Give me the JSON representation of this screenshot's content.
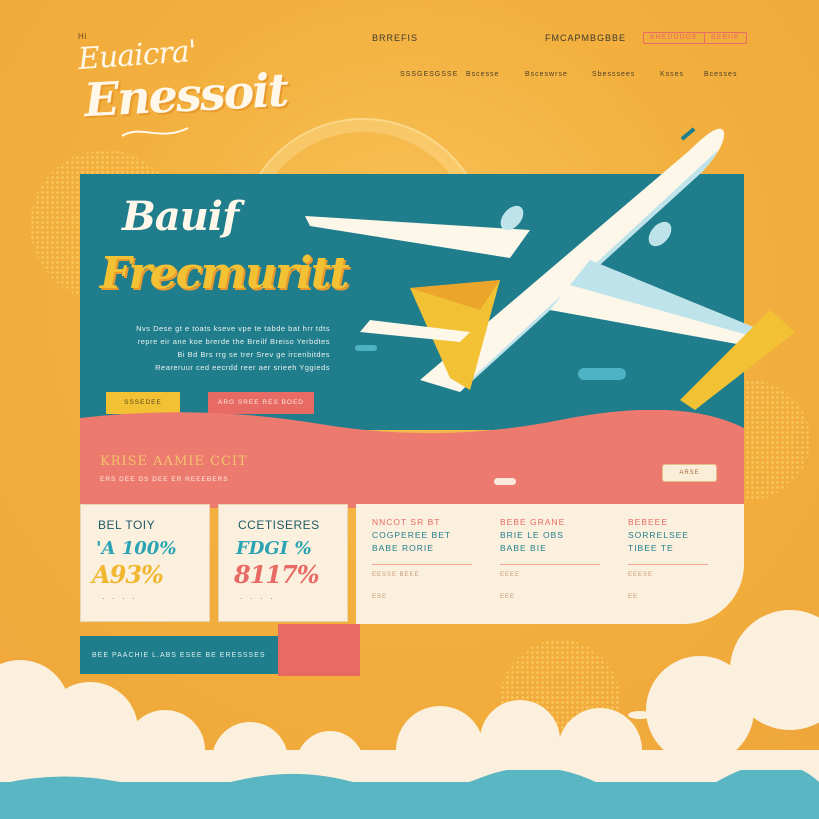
{
  "header": {
    "brand_small": "Hi",
    "brand_script": "Euaicra'",
    "brand_main": "Enessoit",
    "nav_top_center": "BRREFIS",
    "nav_top_right": "FMCAPMBGBBE",
    "nav_pills": [
      "BHEDDDOE",
      "BEBIIE"
    ],
    "nav_row": [
      "SSSGESGSSE",
      "Bscesse",
      "Bsceswrse",
      "Sbesssees",
      "Ksses",
      "Bcesses"
    ]
  },
  "hero": {
    "title_line1": "Bauif",
    "title_line2": "Frecmuritt",
    "body_lines": [
      "Nvs Dese gt e toats kseve vpe te tabde bat hrr tdts",
      "repre eir ane koe brerde the Breilf Breiso Yerbdtes",
      "Bi Bd Brs rrg se trer Srev ge ircenbitdes",
      "Reareruur ced eecrdd reer aer srieeh Yggieds"
    ],
    "button_primary": "SSSEDEE",
    "button_secondary": "ARG SREE RES BOED"
  },
  "band": {
    "title": "KRISE AAMIE CCIT",
    "subtitle": "ERS DEE   DS DEE  ER REEEBERS",
    "button": "ARSE"
  },
  "stats": [
    {
      "label": "BEL TOIY",
      "value_top": "'A 100%",
      "value_bottom": "A93%",
      "bottom_color": "#f2b730",
      "footer": "⠁ ⠁ ⠁ ⠁"
    },
    {
      "label": "CCETISERES",
      "value_top": "FDGI %",
      "value_bottom": "8117%",
      "bottom_color": "#e86a64",
      "footer": "⠁ ⠁ ⠁ ⠁"
    }
  ],
  "info_columns": [
    {
      "title": "NNCOT SR BT",
      "teal": "COGPEREE BET",
      "extra": "BABE RORIE",
      "meta": "EESSE BEEE",
      "foot": "ESE"
    },
    {
      "title": "BEBE GRANE",
      "teal": "BRIE LE OBS",
      "extra": "BABE BIE",
      "meta": "EEEE",
      "foot": "EEE"
    },
    {
      "title": "BEBEEE",
      "teal": "SORRELSEE",
      "extra": "TIBEE TE",
      "meta": "EEESE",
      "foot": "EE"
    }
  ],
  "bottom_bar": {
    "text": "BEE PAACHIE L.ABS ESEE BE ERESSSES"
  }
}
